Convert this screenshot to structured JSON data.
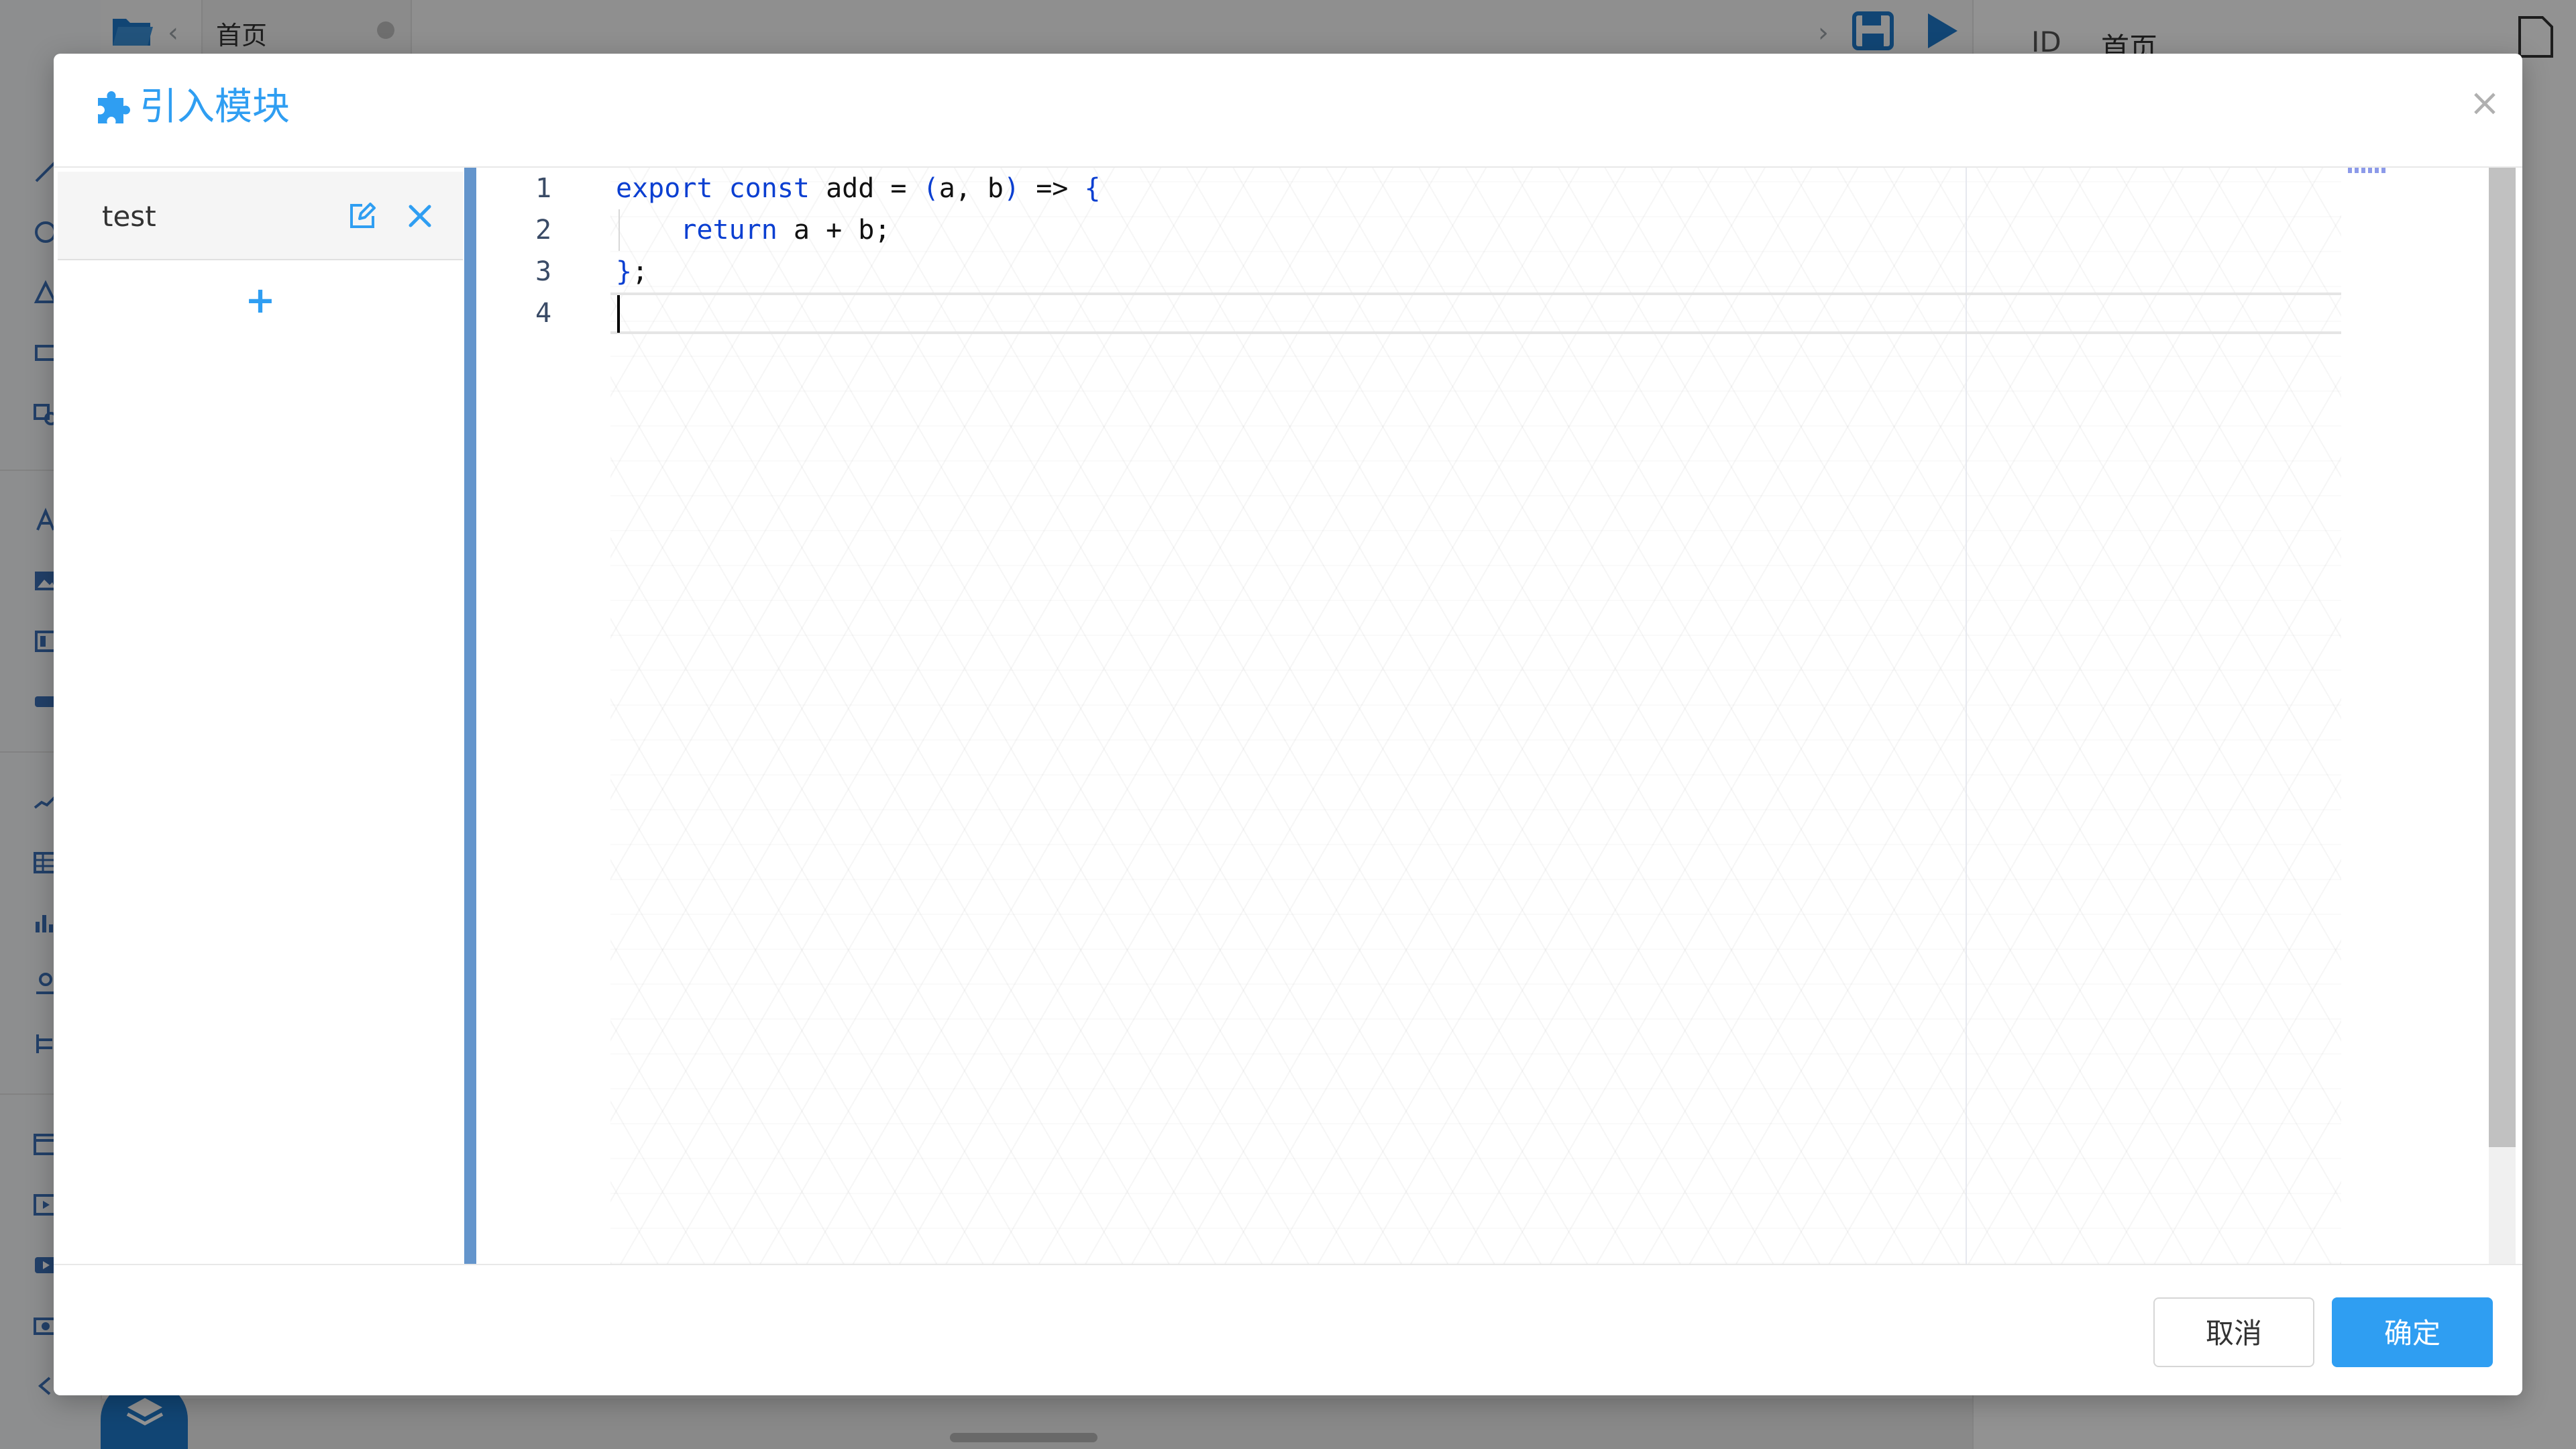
{
  "background": {
    "page_tab_label": "首页",
    "right_panel": {
      "id_label": "ID",
      "page_name": "首页"
    }
  },
  "modal": {
    "title": "引入模块",
    "close_label": "×"
  },
  "modules": [
    {
      "name": "test"
    }
  ],
  "add_module_label": "+",
  "editor": {
    "line_numbers": [
      "1",
      "2",
      "3",
      "4"
    ],
    "code_lines": [
      {
        "segments": [
          {
            "text": "export",
            "cls": "kw"
          },
          {
            "text": " "
          },
          {
            "text": "const",
            "cls": "kw"
          },
          {
            "text": " add = "
          },
          {
            "text": "(",
            "cls": "br"
          },
          {
            "text": "a, b"
          },
          {
            "text": ")",
            "cls": "br"
          },
          {
            "text": " => "
          },
          {
            "text": "{",
            "cls": "br"
          }
        ]
      },
      {
        "segments": [
          {
            "text": "    "
          },
          {
            "text": "return",
            "cls": "kw"
          },
          {
            "text": " a + b;"
          }
        ]
      },
      {
        "segments": [
          {
            "text": "}",
            "cls": "br"
          },
          {
            "text": ";"
          }
        ]
      },
      {
        "segments": []
      }
    ]
  },
  "footer": {
    "cancel_label": "取消",
    "ok_label": "确定"
  },
  "colors": {
    "accent": "#2f9ef2",
    "keyword": "#0b3fd1",
    "divider": "#6495cc"
  }
}
